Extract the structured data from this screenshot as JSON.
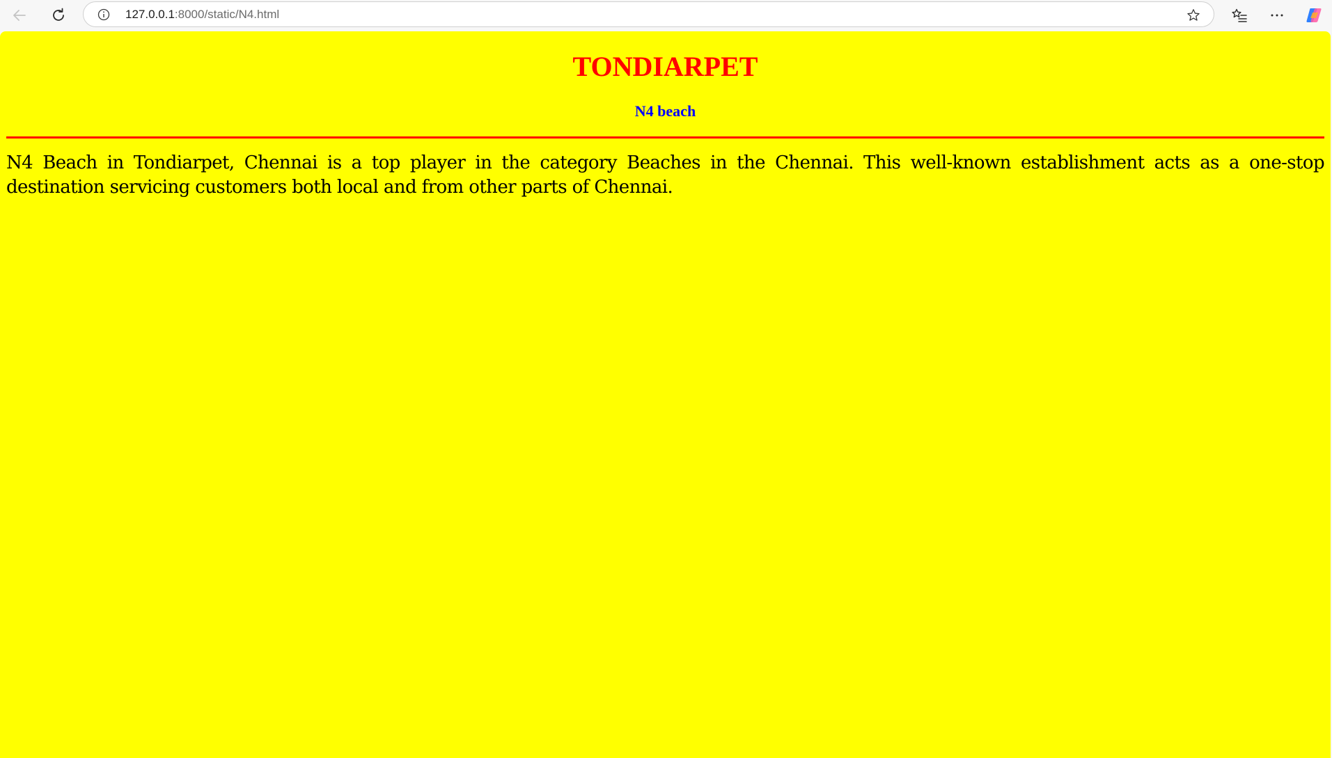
{
  "browser": {
    "url_host": "127.0.0.1",
    "url_rest": ":8000/static/N4.html",
    "icons": {
      "back": "back-arrow-icon",
      "reload": "reload-icon",
      "info": "info-icon",
      "favorite": "star-icon",
      "favorites_list": "favorites-icon",
      "more": "more-icon",
      "copilot": "copilot-icon"
    }
  },
  "page": {
    "title": "TONDIARPET",
    "subtitle": "N4 beach",
    "paragraph": "N4 Beach in Tondiarpet, Chennai is a top player in the category Beaches in the Chennai. This well-known establishment acts as a one-stop destination servicing customers both local and from other parts of Chennai.",
    "colors": {
      "background": "#ffff00",
      "title": "#ff0000",
      "subtitle": "#0000ff",
      "divider": "#ff0000",
      "text": "#000000"
    }
  }
}
